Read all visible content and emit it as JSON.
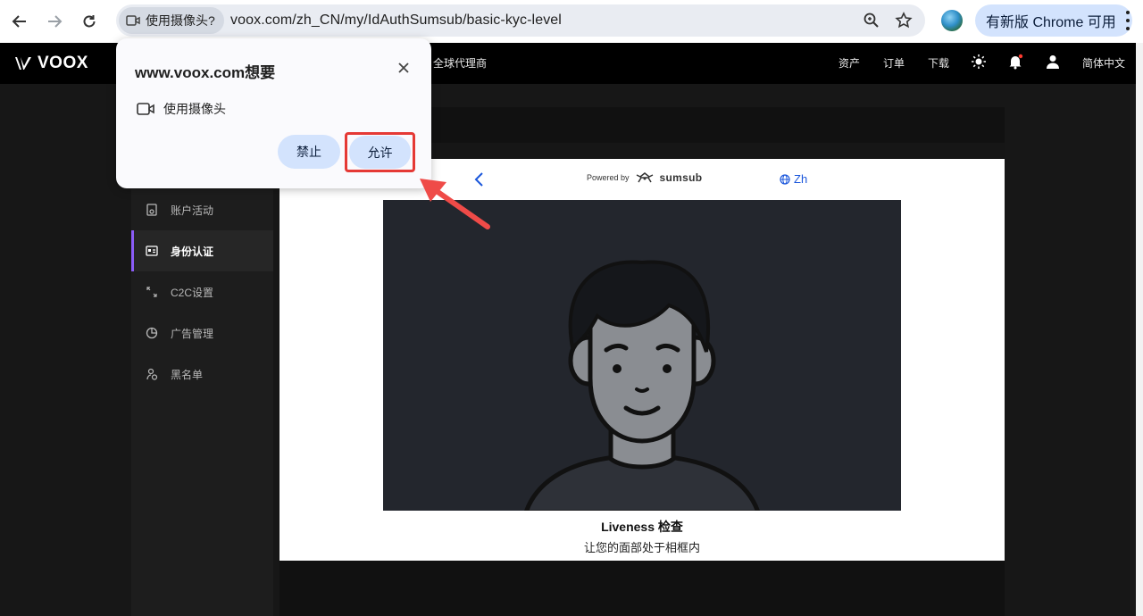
{
  "browser": {
    "permission_chip": "使用摄像头?",
    "url": "voox.com/zh_CN/my/IdAuthSumsub/basic-kyc-level",
    "update_button": "有新版 Chrome 可用"
  },
  "header": {
    "logo_text": "VOOX",
    "nav_partial": "全球代理商",
    "right_nav": [
      "资产",
      "订单",
      "下载"
    ],
    "language": "简体中文"
  },
  "sidebar": {
    "items": [
      {
        "label": "账户活动",
        "icon": "clipboard-icon"
      },
      {
        "label": "身份认证",
        "icon": "id-card-icon",
        "active": true
      },
      {
        "label": "C2C设置",
        "icon": "exchange-icon"
      },
      {
        "label": "广告管理",
        "icon": "pie-chart-icon"
      },
      {
        "label": "黑名单",
        "icon": "user-block-icon"
      }
    ]
  },
  "sumsub": {
    "powered_by": "Powered by",
    "brand": "sumsub",
    "language": "Zh",
    "title": "Liveness 检查",
    "subtitle": "让您的面部处于相框内"
  },
  "popup": {
    "title": "www.voox.com想要",
    "permission": "使用摄像头",
    "block_button": "禁止",
    "allow_button": "允许"
  },
  "colors": {
    "accent": "#8b5cf6",
    "chrome_button": "#d3e3fd",
    "highlight": "#e53935"
  }
}
